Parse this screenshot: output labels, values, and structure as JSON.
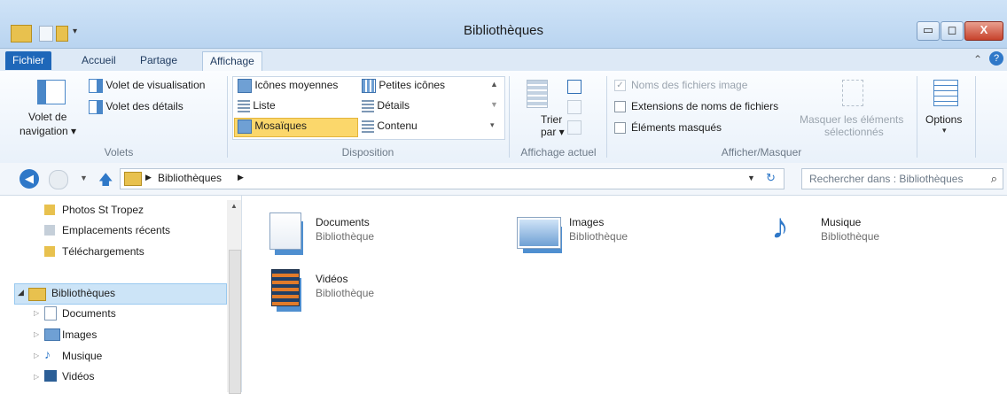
{
  "window": {
    "title": "Bibliothèques"
  },
  "tabs": [
    {
      "label": "Fichier"
    },
    {
      "label": "Accueil"
    },
    {
      "label": "Partage"
    },
    {
      "label": "Affichage"
    }
  ],
  "ribbon": {
    "volets": {
      "nav_line1": "Volet de",
      "nav_line2": "navigation ▾",
      "preview": "Volet de visualisation",
      "details": "Volet des détails",
      "group": "Volets"
    },
    "disposition": {
      "items": [
        "Icônes moyennes",
        "Petites icônes",
        "Liste",
        "Détails",
        "Mosaïques",
        "Contenu"
      ],
      "selected": "Mosaïques",
      "group": "Disposition"
    },
    "affichage_actuel": {
      "sort_line1": "Trier",
      "sort_line2": "par ▾",
      "group": "Affichage actuel"
    },
    "afficher_masquer": {
      "checkboxes": [
        {
          "label": "Noms des fichiers image",
          "checked": true,
          "enabled": false
        },
        {
          "label": "Extensions de noms de fichiers",
          "checked": false,
          "enabled": true
        },
        {
          "label": "Éléments masqués",
          "checked": false,
          "enabled": true
        }
      ],
      "hide_line1": "Masquer les éléments",
      "hide_line2": "sélectionnés",
      "group": "Afficher/Masquer"
    },
    "options": {
      "label": "Options"
    }
  },
  "address": {
    "path": "Bibliothèques",
    "search_placeholder": "Rechercher dans : Bibliothèques"
  },
  "nav": {
    "items_top": [
      "Photos St Tropez",
      "Emplacements récents",
      "Téléchargements"
    ],
    "library_root": "Bibliothèques",
    "libraries": [
      "Documents",
      "Images",
      "Musique",
      "Vidéos"
    ]
  },
  "content": {
    "tiles": [
      {
        "name": "Documents",
        "type": "Bibliothèque"
      },
      {
        "name": "Images",
        "type": "Bibliothèque"
      },
      {
        "name": "Musique",
        "type": "Bibliothèque"
      },
      {
        "name": "Vidéos",
        "type": "Bibliothèque"
      }
    ]
  },
  "colors": {
    "accent": "#1e67b9",
    "selection": "#cce4f7",
    "selected_layout": "#fbd76b"
  }
}
